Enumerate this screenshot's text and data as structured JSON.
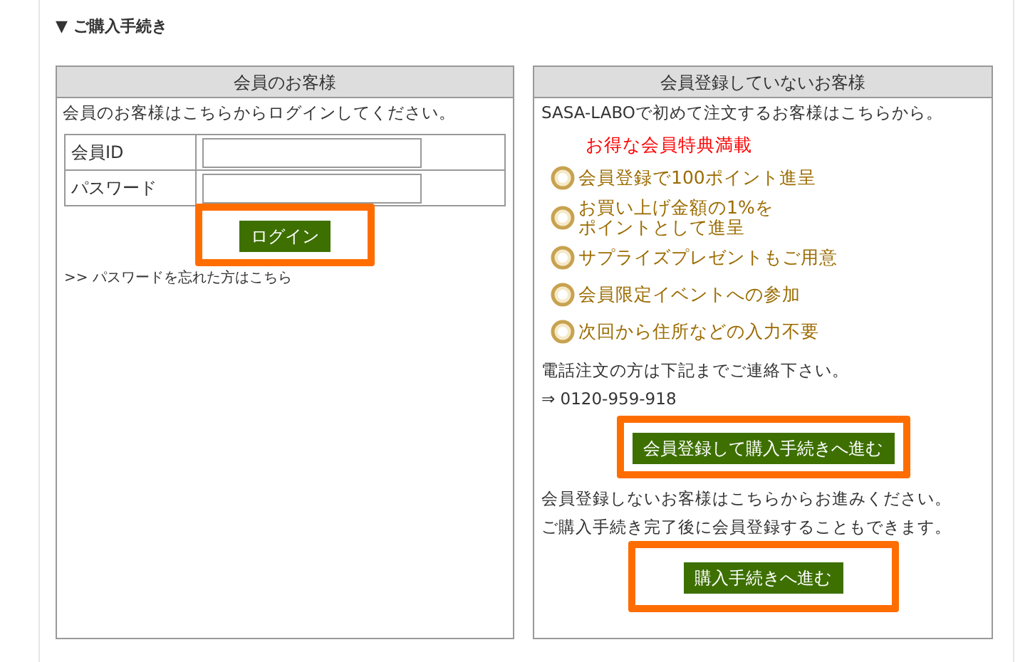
{
  "heading": "▼ ご購入手続き",
  "member": {
    "title": "会員のお客様",
    "intro": "会員のお客様はこちらからログインしてください。",
    "fields": [
      {
        "label": "会員ID"
      },
      {
        "label": "パスワード"
      }
    ],
    "login_button": {
      "label": "ログイン",
      "highlighted": true
    },
    "forgot_link": ">> パスワードを忘れた方はこちら"
  },
  "guest": {
    "title": "会員登録していないお客様",
    "intro": "SASA-LABOで初めて注文するお客様はこちらから。",
    "benefits_title": "お得な会員特典満載",
    "benefits": [
      {
        "lines": [
          "会員登録で100ポイント進呈"
        ]
      },
      {
        "lines": [
          "お買い上げ金額の1%を",
          "ポイントとして進呈"
        ]
      },
      {
        "lines": [
          "サプライズプレゼントもご用意"
        ]
      },
      {
        "lines": [
          "会員限定イベントへの参加"
        ]
      },
      {
        "lines": [
          "次回から住所などの入力不要"
        ]
      }
    ],
    "phone_note": "電話注文の方は下記までご連絡下さい。",
    "phone": "⇒ 0120-959-918",
    "register_button": {
      "label": "会員登録して購入手続きへ進む",
      "highlighted": true
    },
    "guest_note": [
      "会員登録しないお客様はこちらからお進みください。",
      "ご購入手続き完了後に会員登録することもできます。"
    ],
    "guest_button": {
      "label": "購入手続きへ進む",
      "highlighted": true
    }
  }
}
